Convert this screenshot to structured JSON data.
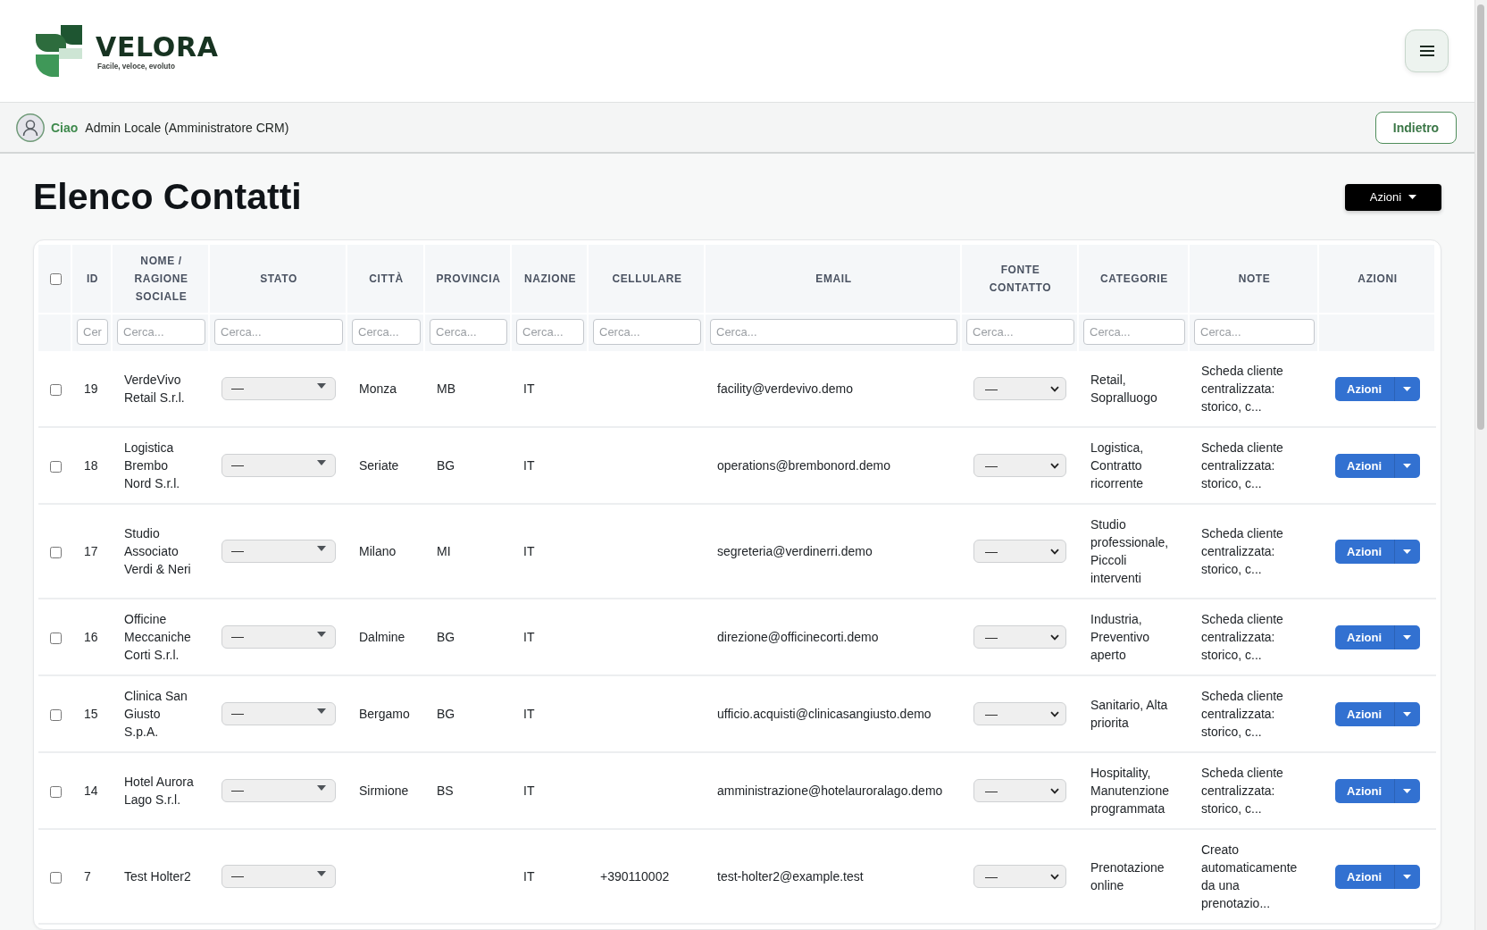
{
  "header": {
    "logo": {
      "name": "VELORA",
      "tagline": "Facile, veloce, evoluto"
    }
  },
  "user_bar": {
    "greeting": "Ciao",
    "user": "Admin Locale (Amministratore CRM)",
    "back_button": "Indietro"
  },
  "page": {
    "title": "Elenco Contatti",
    "actions_button": "Azioni"
  },
  "table": {
    "select_all": {
      "checked": false
    },
    "columns": [
      {
        "label": "ID",
        "kind": "text",
        "placeholder": "Cer"
      },
      {
        "label": "NOME / RAGIONE SOCIALE",
        "kind": "text",
        "placeholder": "Cerca..."
      },
      {
        "label": "STATO",
        "kind": "dropdown",
        "placeholder": "Cerca..."
      },
      {
        "label": "CITTÀ",
        "kind": "text",
        "placeholder": "Cerca..."
      },
      {
        "label": "PROVINCIA",
        "kind": "text",
        "placeholder": "Cerca..."
      },
      {
        "label": "NAZIONE",
        "kind": "text",
        "placeholder": "Cerca..."
      },
      {
        "label": "CELLULARE",
        "kind": "text",
        "placeholder": "Cerca..."
      },
      {
        "label": "EMAIL",
        "kind": "text",
        "placeholder": "Cerca..."
      },
      {
        "label": "FONTE CONTATTO",
        "kind": "select",
        "placeholder": "Cerca..."
      },
      {
        "label": "CATEGORIE",
        "kind": "text",
        "placeholder": "Cerca..."
      },
      {
        "label": "NOTE",
        "kind": "text",
        "placeholder": "Cerca..."
      },
      {
        "label": "AZIONI",
        "kind": "split_button"
      }
    ],
    "rows": [
      {
        "selected": false,
        "id": "19",
        "name": "VerdeVivo Retail S.r.l.",
        "status": "—",
        "city": "Monza",
        "province": "MB",
        "country": "IT",
        "email": "facility@verdevivo.demo",
        "source": "—",
        "categories": "Retail, Sopralluogo",
        "notes": "Scheda cliente centralizzata: storico, c...",
        "action": "Azioni"
      },
      {
        "selected": false,
        "id": "18",
        "name": "Logistica Brembo Nord S.r.l.",
        "status": "—",
        "city": "Seriate",
        "province": "BG",
        "country": "IT",
        "email": "operations@brembonord.demo",
        "source": "—",
        "categories": "Logistica, Contratto ricorrente",
        "notes": "Scheda cliente centralizzata: storico, c...",
        "action": "Azioni"
      },
      {
        "selected": false,
        "id": "17",
        "name": "Studio Associato Verdi & Neri",
        "status": "—",
        "city": "Milano",
        "province": "MI",
        "country": "IT",
        "email": "segreteria@verdinerri.demo",
        "source": "—",
        "categories": "Studio professionale, Piccoli interventi",
        "notes": "Scheda cliente centralizzata: storico, c...",
        "action": "Azioni"
      },
      {
        "selected": false,
        "id": "16",
        "name": "Officine Meccaniche Corti S.r.l.",
        "status": "—",
        "city": "Dalmine",
        "province": "BG",
        "country": "IT",
        "email": "direzione@officinecorti.demo",
        "source": "—",
        "categories": "Industria, Preventivo aperto",
        "notes": "Scheda cliente centralizzata: storico, c...",
        "action": "Azioni"
      },
      {
        "selected": false,
        "id": "15",
        "name": "Clinica San Giusto S.p.A.",
        "status": "—",
        "city": "Bergamo",
        "province": "BG",
        "country": "IT",
        "email": "ufficio.acquisti@clinicasangiusto.demo",
        "source": "—",
        "categories": "Sanitario, Alta priorita",
        "notes": "Scheda cliente centralizzata: storico, c...",
        "action": "Azioni"
      },
      {
        "selected": false,
        "id": "14",
        "name": "Hotel Aurora Lago S.r.l.",
        "status": "—",
        "city": "Sirmione",
        "province": "BS",
        "country": "IT",
        "email": "amministrazione@hotelauroralago.demo",
        "source": "—",
        "categories": "Hospitality, Manutenzione programmata",
        "notes": "Scheda cliente centralizzata: storico, c...",
        "action": "Azioni"
      },
      {
        "selected": false,
        "id": "7",
        "name": "Test Holter2",
        "status": "—",
        "country": "IT",
        "mobile": "+390110002",
        "email": "test-holter2@example.test",
        "source": "—",
        "categories": "Prenotazione online",
        "notes": "Creato automaticamente da una prenotazio...",
        "action": "Azioni"
      }
    ]
  }
}
